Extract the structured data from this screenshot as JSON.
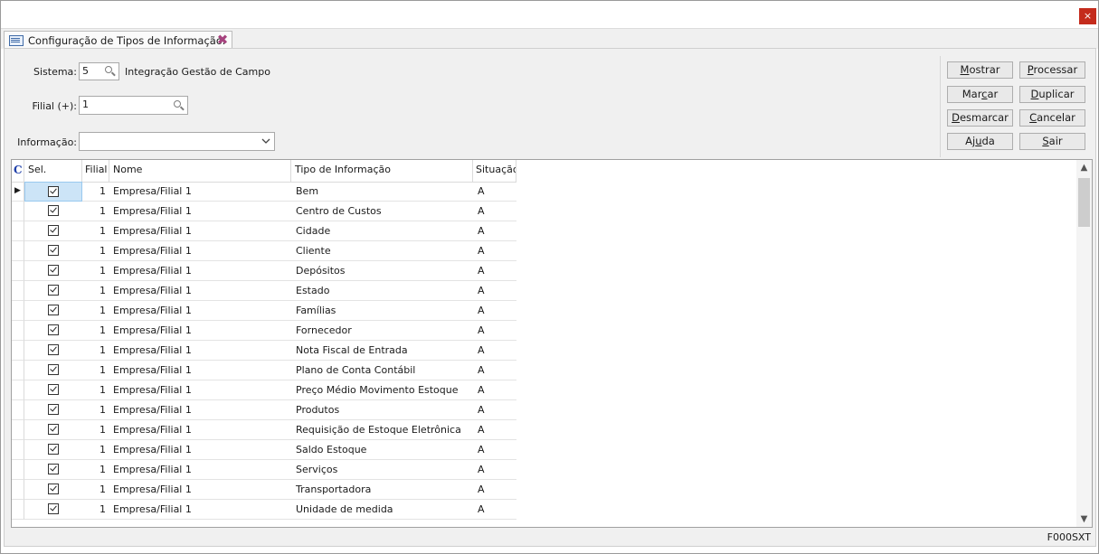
{
  "window": {
    "close_glyph": "×"
  },
  "tab": {
    "title": "Configuração de  Tipos de Informação.",
    "close_glyph": "✖"
  },
  "form": {
    "sistema_label": "Sistema:",
    "sistema_value": "5",
    "sistema_desc": "Integração Gestão de Campo",
    "filial_label": "Filial (+):",
    "filial_value": "1",
    "informacao_label": "Informação:",
    "informacao_value": ""
  },
  "buttons": [
    {
      "key": "M",
      "rest": "ostrar",
      "pre": ""
    },
    {
      "key": "P",
      "rest": "rocessar",
      "pre": ""
    },
    {
      "key": "c",
      "rest": "ar",
      "pre": "Mar"
    },
    {
      "key": "D",
      "rest": "uplicar",
      "pre": ""
    },
    {
      "key": "D",
      "rest": "esmarcar",
      "pre": ""
    },
    {
      "key": "C",
      "rest": "ancelar",
      "pre": ""
    },
    {
      "key": "u",
      "rest": "da",
      "pre": "Aj"
    },
    {
      "key": "S",
      "rest": "air",
      "pre": ""
    }
  ],
  "grid": {
    "corner": "C",
    "columns": [
      "Sel.",
      "Filial",
      "Nome",
      "Tipo de Informação",
      "Situação"
    ],
    "current_row_marker": "▶",
    "rows": [
      {
        "sel": true,
        "filial": "1",
        "nome": "Empresa/Filial 1",
        "tipo": "Bem",
        "situacao": "A"
      },
      {
        "sel": true,
        "filial": "1",
        "nome": "Empresa/Filial 1",
        "tipo": "Centro de Custos",
        "situacao": "A"
      },
      {
        "sel": true,
        "filial": "1",
        "nome": "Empresa/Filial 1",
        "tipo": "Cidade",
        "situacao": "A"
      },
      {
        "sel": true,
        "filial": "1",
        "nome": "Empresa/Filial 1",
        "tipo": "Cliente",
        "situacao": "A"
      },
      {
        "sel": true,
        "filial": "1",
        "nome": "Empresa/Filial 1",
        "tipo": "Depósitos",
        "situacao": "A"
      },
      {
        "sel": true,
        "filial": "1",
        "nome": "Empresa/Filial 1",
        "tipo": "Estado",
        "situacao": "A"
      },
      {
        "sel": true,
        "filial": "1",
        "nome": "Empresa/Filial 1",
        "tipo": "Famílias",
        "situacao": "A"
      },
      {
        "sel": true,
        "filial": "1",
        "nome": "Empresa/Filial 1",
        "tipo": "Fornecedor",
        "situacao": "A"
      },
      {
        "sel": true,
        "filial": "1",
        "nome": "Empresa/Filial 1",
        "tipo": "Nota Fiscal de Entrada",
        "situacao": "A"
      },
      {
        "sel": true,
        "filial": "1",
        "nome": "Empresa/Filial 1",
        "tipo": "Plano de Conta Contábil",
        "situacao": "A"
      },
      {
        "sel": true,
        "filial": "1",
        "nome": "Empresa/Filial 1",
        "tipo": "Preço Médio Movimento Estoque",
        "situacao": "A"
      },
      {
        "sel": true,
        "filial": "1",
        "nome": "Empresa/Filial 1",
        "tipo": "Produtos",
        "situacao": "A"
      },
      {
        "sel": true,
        "filial": "1",
        "nome": "Empresa/Filial 1",
        "tipo": "Requisição de Estoque Eletrônica",
        "situacao": "A"
      },
      {
        "sel": true,
        "filial": "1",
        "nome": "Empresa/Filial 1",
        "tipo": "Saldo Estoque",
        "situacao": "A"
      },
      {
        "sel": true,
        "filial": "1",
        "nome": "Empresa/Filial 1",
        "tipo": "Serviços",
        "situacao": "A"
      },
      {
        "sel": true,
        "filial": "1",
        "nome": "Empresa/Filial 1",
        "tipo": "Transportadora",
        "situacao": "A"
      },
      {
        "sel": true,
        "filial": "1",
        "nome": "Empresa/Filial 1",
        "tipo": "Unidade de medida",
        "situacao": "A"
      }
    ]
  },
  "scrollbar": {
    "up_glyph": "▲",
    "down_glyph": "▼"
  },
  "status": {
    "code": "F000SXT"
  }
}
